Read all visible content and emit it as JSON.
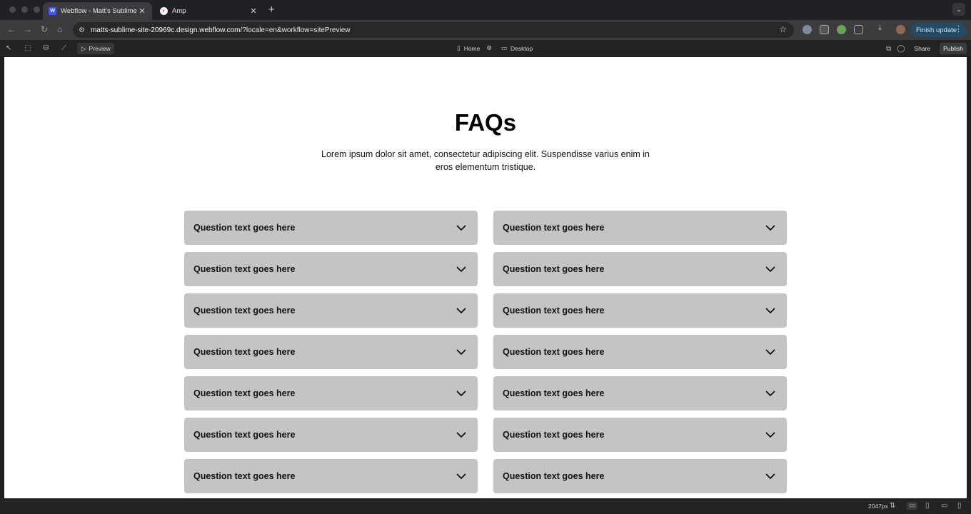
{
  "browser": {
    "tabs": [
      {
        "title": "Webflow - Matt's Sublime Site",
        "favicon": "webflow-icon",
        "active": true
      },
      {
        "title": "Amp",
        "favicon": "amp-icon",
        "active": false
      }
    ],
    "new_tab_label": "+",
    "url_host": "matts-sublime-site-20969c.design.webflow.com",
    "url_rest": "/?locale=en&workflow=sitePreview",
    "finish_update_label": "Finish update"
  },
  "webflow_toolbar": {
    "preview_label": "Preview",
    "page_label": "Home",
    "breakpoint_label": "Desktop",
    "share_label": "Share",
    "publish_label": "Publish"
  },
  "page": {
    "title": "FAQs",
    "subtitle": "Lorem ipsum dolor sit amet, consectetur adipiscing elit. Suspendisse varius enim in eros elementum tristique.",
    "faqs": [
      {
        "question": "Question text goes here"
      },
      {
        "question": "Question text goes here"
      },
      {
        "question": "Question text goes here"
      },
      {
        "question": "Question text goes here"
      },
      {
        "question": "Question text goes here"
      },
      {
        "question": "Question text goes here"
      },
      {
        "question": "Question text goes here"
      },
      {
        "question": "Question text goes here"
      },
      {
        "question": "Question text goes here"
      },
      {
        "question": "Question text goes here"
      },
      {
        "question": "Question text goes here"
      },
      {
        "question": "Question text goes here"
      },
      {
        "question": "Question text goes here"
      },
      {
        "question": "Question text goes here"
      }
    ]
  },
  "bottom_bar": {
    "canvas_width_label": "2047px"
  },
  "colors": {
    "faq_item_bg": "#c4c4c4",
    "canvas_bg": "#ffffff",
    "chrome_bg": "#202124",
    "finish_update_bg": "#244a66"
  }
}
